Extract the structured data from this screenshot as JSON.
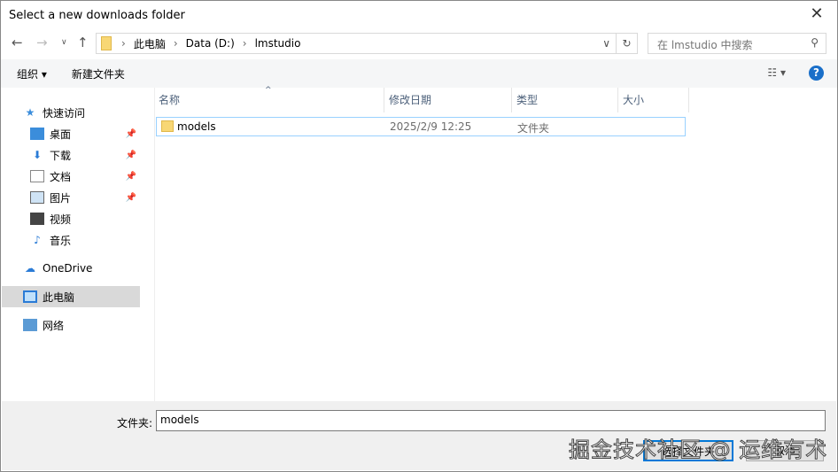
{
  "title": "Select a new downloads folder",
  "address": {
    "crumbs": [
      "此电脑",
      "Data (D:)",
      "lmstudio"
    ]
  },
  "search": {
    "placeholder": "在 lmstudio 中搜索"
  },
  "toolbar": {
    "organize": "组织 ▾",
    "new_folder": "新建文件夹"
  },
  "sidebar": {
    "quick_access": "快速访问",
    "items": [
      "桌面",
      "下载",
      "文档",
      "图片",
      "视频",
      "音乐"
    ],
    "onedrive": "OneDrive",
    "this_pc": "此电脑",
    "network": "网络"
  },
  "columns": [
    "名称",
    "修改日期",
    "类型",
    "大小"
  ],
  "files": [
    {
      "name": "models",
      "date": "2025/2/9 12:25",
      "type": "文件夹",
      "size": ""
    }
  ],
  "footer": {
    "filename_label": "文件夹:",
    "filename_value": "models",
    "select_button": "选择文件夹",
    "cancel_button": "取消"
  },
  "watermark": "掘金技术社区 @ 运维有术"
}
